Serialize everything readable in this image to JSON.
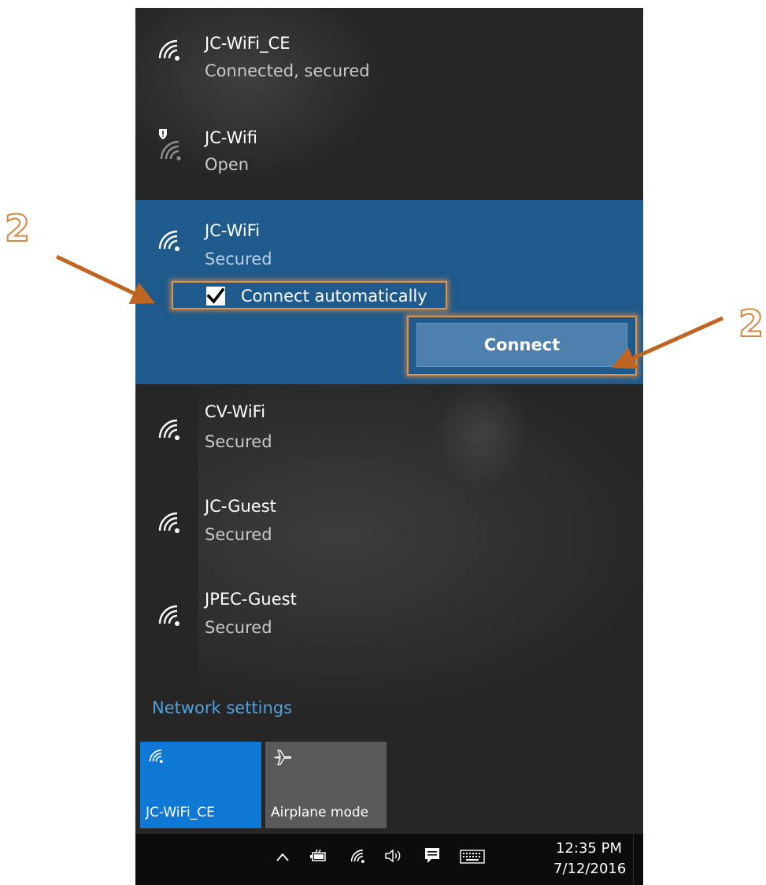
{
  "networks": [
    {
      "name": "JC-WiFi_CE",
      "status": "Connected, secured",
      "icon": "wifi-icon"
    },
    {
      "name": "JC-Wifi",
      "status": "Open",
      "icon": "wifi-open-warning-icon"
    },
    {
      "name": "JC-WiFi",
      "status": "Secured",
      "icon": "wifi-icon"
    },
    {
      "name": "CV-WiFi",
      "status": "Secured",
      "icon": "wifi-icon"
    },
    {
      "name": "JC-Guest",
      "status": "Secured",
      "icon": "wifi-icon"
    },
    {
      "name": "JPEC-Guest",
      "status": "Secured",
      "icon": "wifi-icon"
    }
  ],
  "selected": {
    "connect_auto_label": "Connect automatically",
    "connect_auto_checked": true,
    "connect_button": "Connect"
  },
  "network_settings_link": "Network settings",
  "quick_actions": [
    {
      "label": "JC-WiFi_CE",
      "icon": "wifi-icon",
      "active": true
    },
    {
      "label": "Airplane mode",
      "icon": "airplane-icon",
      "active": false
    }
  ],
  "taskbar": {
    "time": "12:35 PM",
    "date": "7/12/2016",
    "icons": [
      "chevron-up-icon",
      "battery-icon",
      "wifi-icon",
      "volume-icon",
      "action-center-icon",
      "keyboard-icon"
    ]
  },
  "callouts": [
    "2",
    "2"
  ],
  "colors": {
    "panel_bg": "#262626",
    "selected_bg": "#1f5a8c",
    "accent": "#0f78d4",
    "link": "#4fa2e0",
    "callout_orange": "#d8873e"
  }
}
